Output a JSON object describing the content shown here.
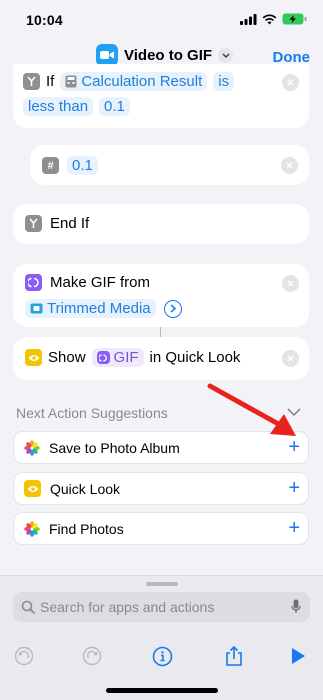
{
  "status": {
    "time": "10:04"
  },
  "nav": {
    "title": "Video to GIF",
    "done_label": "Done"
  },
  "actions": {
    "if_keyword": "If",
    "condition_variable": "Calculation Result",
    "condition_operator": "is",
    "condition_operator_2": "less than",
    "condition_value": "0.1",
    "number_value": "0.1",
    "end_if_label": "End If",
    "make_gif_label": "Make GIF from",
    "make_gif_input": "Trimmed Media",
    "show_label": "Show",
    "show_variable": "GIF",
    "show_suffix": "in Quick Look"
  },
  "suggestions": {
    "title": "Next Action Suggestions",
    "items": [
      {
        "label": "Save to Photo Album"
      },
      {
        "label": "Quick Look"
      },
      {
        "label": "Find Photos"
      }
    ]
  },
  "search": {
    "placeholder": "Search for apps and actions"
  },
  "colors": {
    "accent": "#1979f2",
    "annotation_arrow": "#e8231f"
  }
}
